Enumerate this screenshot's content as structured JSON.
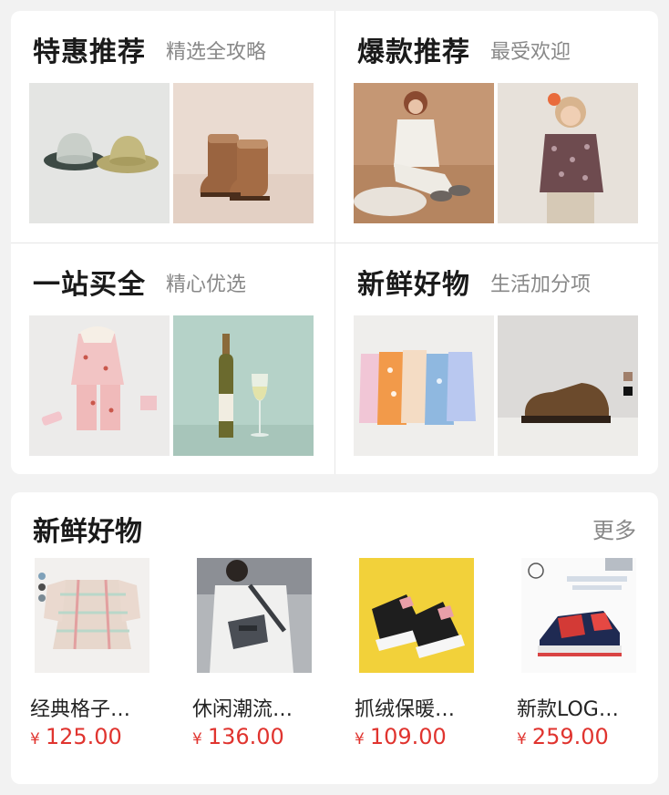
{
  "promo_cards": [
    {
      "title": "特惠推荐",
      "subtitle": "精选全攻略",
      "images": [
        "bucket-hats-photo",
        "suede-boots-photo"
      ]
    },
    {
      "title": "爆款推荐",
      "subtitle": "最受欢迎",
      "images": [
        "woman-knit-outfit-photo",
        "girl-floral-top-photo"
      ]
    },
    {
      "title": "一站买全",
      "subtitle": "精心优选",
      "images": [
        "baby-pink-set-photo",
        "white-wine-photo"
      ]
    },
    {
      "title": "新鲜好物",
      "subtitle": "生活加分项",
      "images": [
        "baby-romper-set-photo",
        "brown-oxford-shoe-photo"
      ]
    }
  ],
  "fresh_goods": {
    "title": "新鲜好物",
    "more_label": "更多",
    "products": [
      {
        "name": "经典格子…",
        "currency": "¥",
        "price": "125.00",
        "image": "plaid-jacket-photo"
      },
      {
        "name": "休闲潮流…",
        "currency": "¥",
        "price": "136.00",
        "image": "crossbody-bag-photo"
      },
      {
        "name": "抓绒保暖…",
        "currency": "¥",
        "price": "109.00",
        "image": "kids-sneakers-photo"
      },
      {
        "name": "新款LOG…",
        "currency": "¥",
        "price": "259.00",
        "image": "red-kids-shoes-photo"
      }
    ]
  },
  "colors": {
    "accent_price": "#e0342f",
    "subtitle_gray": "#888888",
    "background": "#f2f2f2"
  }
}
